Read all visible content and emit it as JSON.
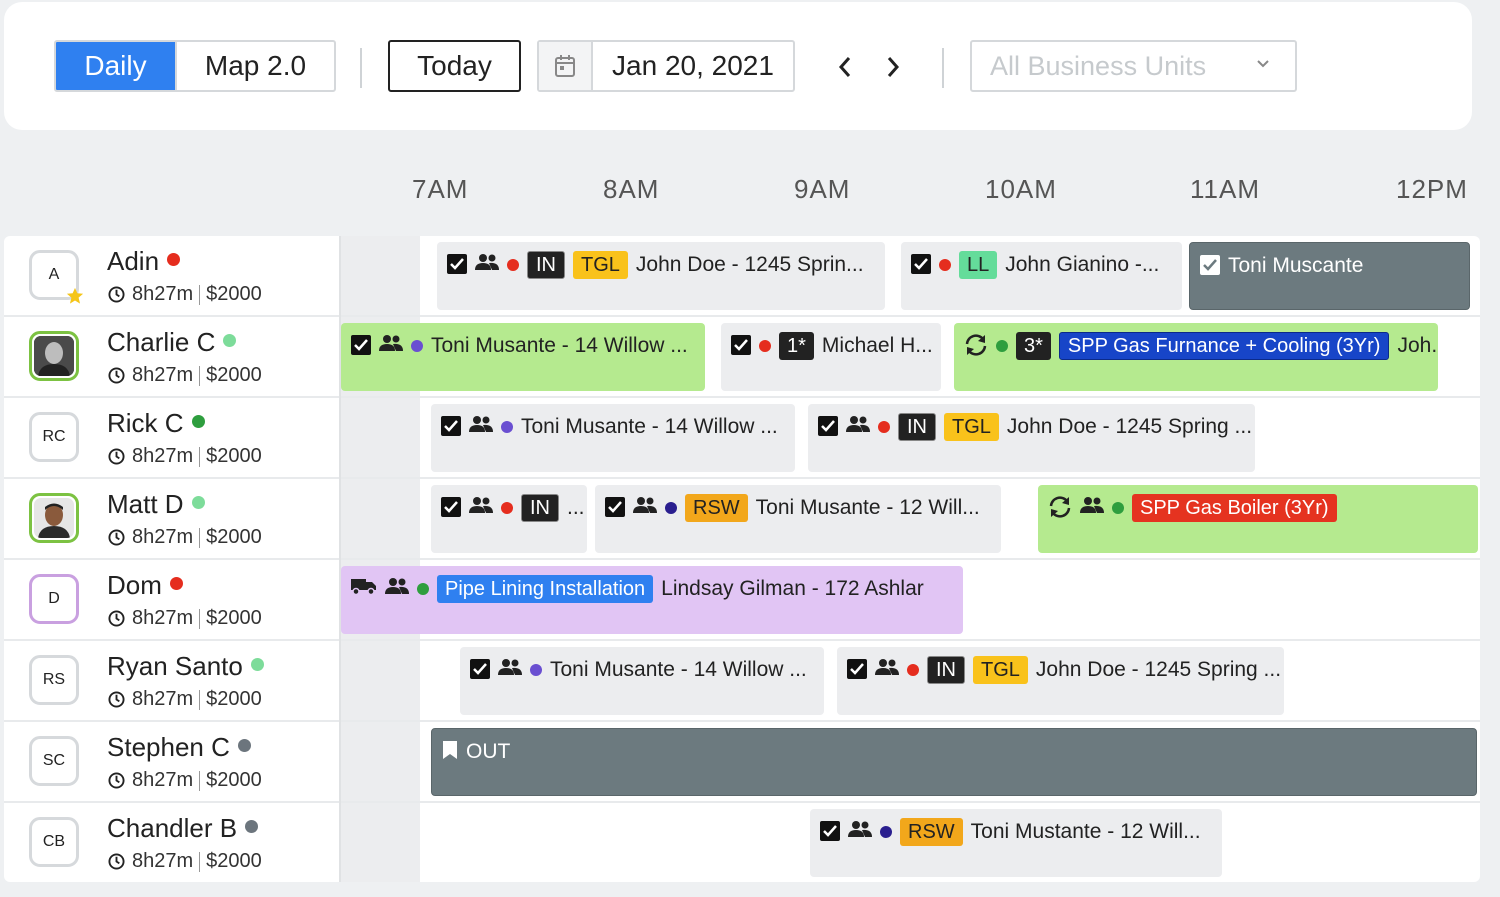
{
  "toolbar": {
    "view_daily": "Daily",
    "view_map": "Map 2.0",
    "today": "Today",
    "date": "Jan 20, 2021",
    "business_units_placeholder": "All Business Units"
  },
  "timeline": {
    "hours": [
      "7AM",
      "8AM",
      "9AM",
      "10AM",
      "11AM",
      "12PM"
    ]
  },
  "colors": {
    "accent_blue": "#2f80f0",
    "job_green": "#b5ea8f",
    "job_purple": "#e1c5f4",
    "job_grey": "#ecedef",
    "job_dark": "#6c7a7f",
    "status_red": "#e52d1e",
    "status_green": "#2e9e3e",
    "status_lightgreen": "#7ddc9a",
    "status_grey": "#6c757d"
  },
  "technicians": [
    {
      "initials": "A",
      "name": "Adin",
      "hours": "8h27m",
      "amount": "$2000",
      "status": "red",
      "favorite": true
    },
    {
      "initials": "",
      "name": "Charlie C",
      "hours": "8h27m",
      "amount": "$2000",
      "status": "lightgreen",
      "photo": true
    },
    {
      "initials": "RC",
      "name": "Rick C",
      "hours": "8h27m",
      "amount": "$2000",
      "status": "green"
    },
    {
      "initials": "",
      "name": "Matt D",
      "hours": "8h27m",
      "amount": "$2000",
      "status": "lightgreen",
      "photo": true
    },
    {
      "initials": "D",
      "name": "Dom",
      "hours": "8h27m",
      "amount": "$2000",
      "status": "red"
    },
    {
      "initials": "RS",
      "name": "Ryan Santo",
      "hours": "8h27m",
      "amount": "$2000",
      "status": "lightgreen"
    },
    {
      "initials": "SC",
      "name": "Stephen C",
      "hours": "8h27m",
      "amount": "$2000",
      "status": "grey"
    },
    {
      "initials": "CB",
      "name": "Chandler B",
      "hours": "8h27m",
      "amount": "$2000",
      "status": "grey"
    }
  ],
  "jobs": {
    "r0": [
      {
        "tags": [
          "IN",
          "TGL"
        ],
        "text": "John Doe - 1245 Sprin..."
      },
      {
        "tags": [
          "LL"
        ],
        "text": "John Gianino -..."
      },
      {
        "text": "Toni Muscante"
      }
    ],
    "r1": [
      {
        "text": "Toni Musante - 14 Willow ..."
      },
      {
        "tags": [
          "1*"
        ],
        "text": "Michael H..."
      },
      {
        "tags": [
          "3*",
          "SPP Gas Furnance + Cooling (3Yr)"
        ],
        "text": "Joh..."
      }
    ],
    "r2": [
      {
        "text": "Toni Musante - 14 Willow ..."
      },
      {
        "tags": [
          "IN",
          "TGL"
        ],
        "text": "John Doe - 1245 Spring ..."
      }
    ],
    "r3": [
      {
        "tags": [
          "IN"
        ],
        "text": "..."
      },
      {
        "tags": [
          "RSW"
        ],
        "text": "Toni Musante - 12 Will..."
      },
      {
        "tags": [
          "SPP Gas Boiler (3Yr)"
        ]
      }
    ],
    "r4": [
      {
        "tags": [
          "Pipe Lining Installation"
        ],
        "text": "Lindsay Gilman - 172 Ashlar"
      }
    ],
    "r5": [
      {
        "text": "Toni Musante - 14 Willow ..."
      },
      {
        "tags": [
          "IN",
          "TGL"
        ],
        "text": "John Doe - 1245 Spring ..."
      }
    ],
    "r6": [
      {
        "text": "OUT"
      }
    ],
    "r7": [
      {
        "tags": [
          "RSW"
        ],
        "text": "Toni Mustante - 12 Will..."
      }
    ]
  }
}
